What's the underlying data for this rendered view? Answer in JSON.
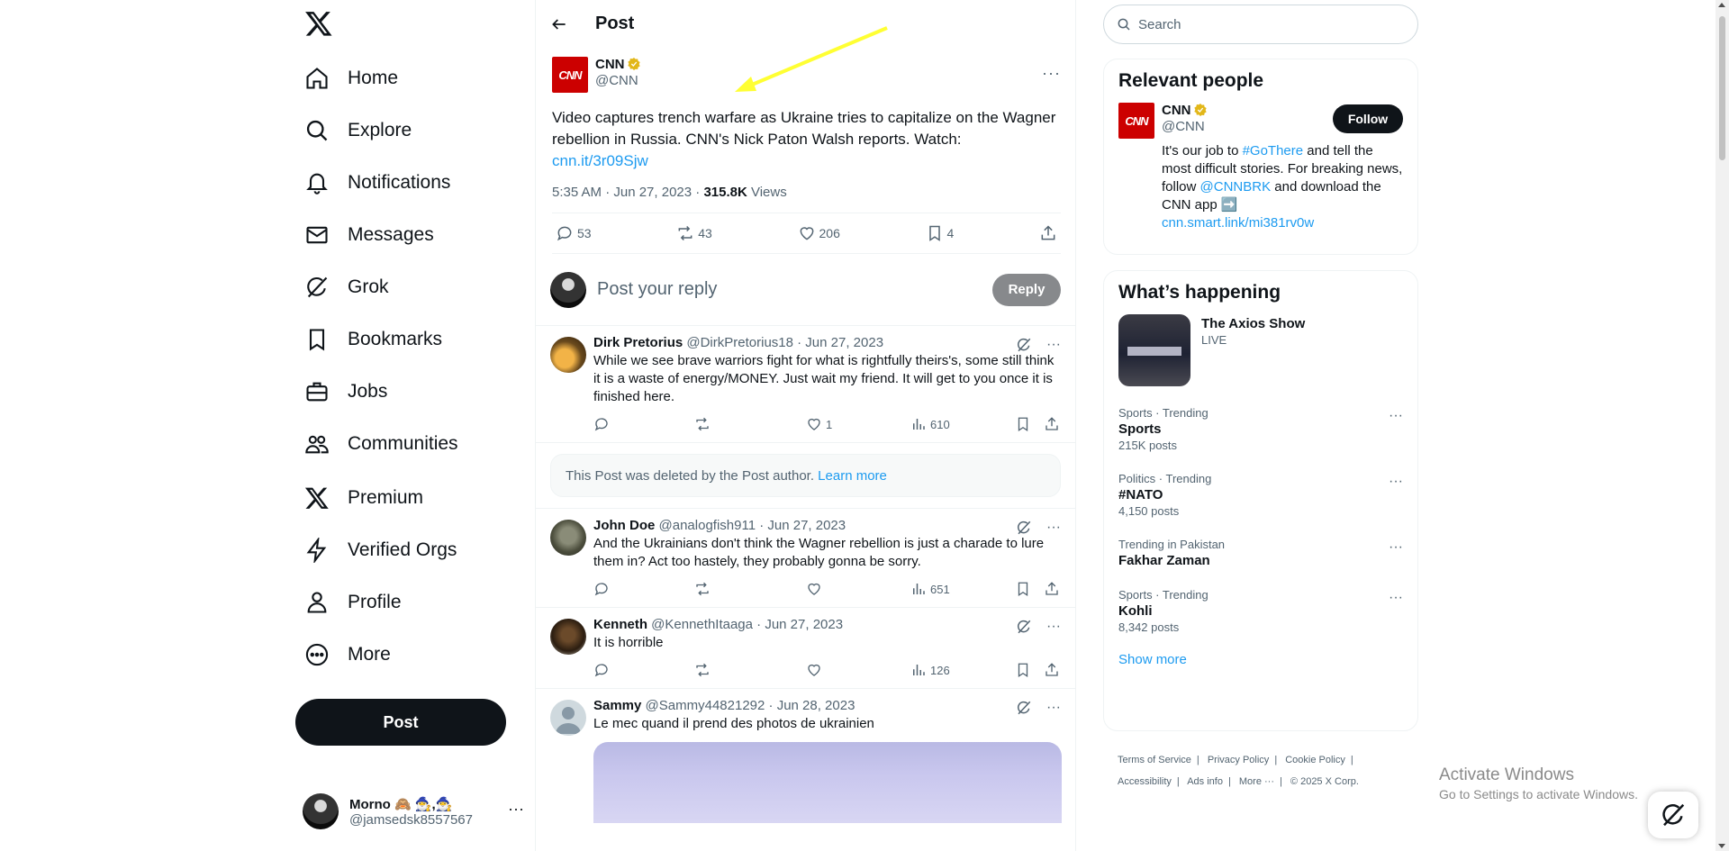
{
  "colors": {
    "accent": "#1d9bf0",
    "text": "#0f1419",
    "muted": "#536471",
    "cnn_red": "#cc0000",
    "annotation_arrow": "#ffff33"
  },
  "sidebar": {
    "logo_icon": "x-logo-icon",
    "items": [
      {
        "label": "Home",
        "icon": "home-icon"
      },
      {
        "label": "Explore",
        "icon": "search-icon"
      },
      {
        "label": "Notifications",
        "icon": "bell-icon"
      },
      {
        "label": "Messages",
        "icon": "mail-icon"
      },
      {
        "label": "Grok",
        "icon": "grok-icon"
      },
      {
        "label": "Bookmarks",
        "icon": "bookmark-icon"
      },
      {
        "label": "Jobs",
        "icon": "briefcase-icon"
      },
      {
        "label": "Communities",
        "icon": "people-icon"
      },
      {
        "label": "Premium",
        "icon": "x-logo-icon"
      },
      {
        "label": "Verified Orgs",
        "icon": "lightning-icon"
      },
      {
        "label": "Profile",
        "icon": "person-icon"
      },
      {
        "label": "More",
        "icon": "more-circle-icon"
      }
    ],
    "post_label": "Post",
    "account": {
      "name": "Morno 🙈 🧙‍♂️,🧙‍♂️",
      "handle": "@jamsedsk8557567"
    }
  },
  "main": {
    "header_title": "Post",
    "post": {
      "author_name": "CNN",
      "author_handle": "@CNN",
      "avatar_text": "CNN",
      "text": "Video captures trench warfare as Ukraine tries to capitalize on the Wagner rebellion in Russia. CNN's Nick Paton Walsh reports. Watch:",
      "link": "cnn.it/3r09Sjw",
      "timestamp": "5:35 AM · Jun 27, 2023 · ",
      "views_count": "315.8K",
      "views_label": " Views",
      "replies": "53",
      "reposts": "43",
      "likes": "206",
      "bookmarks": "4"
    },
    "reply_box": {
      "placeholder": "Post your reply",
      "button": "Reply"
    },
    "replies": [
      {
        "name": "Dirk Pretorius",
        "handle": "@DirkPretorius18",
        "date": " · Jun 27, 2023",
        "text": "While we see brave warriors fight for what is rightfully theirs's, some still think it is a waste of energy/MONEY. Just wait my friend. It will get to you once it is finished here.",
        "likes": "1",
        "views": "610"
      },
      {
        "name": "John Doe",
        "handle": "@analogfish911",
        "date": " · Jun 27, 2023",
        "text": "And the Ukrainians don't think the Wagner rebellion is just a charade to lure them in? Act too hastely, they probably gonna be sorry.",
        "likes": "",
        "views": "651"
      },
      {
        "name": "Kenneth",
        "handle": "@KennethItaaga",
        "date": " · Jun 27, 2023",
        "text": "It is horrible",
        "likes": "",
        "views": "126"
      },
      {
        "name": "Sammy",
        "handle": "@Sammy44821292",
        "date": " · Jun 28, 2023",
        "text": "Le mec quand il prend des photos de ukrainien"
      }
    ],
    "deleted_notice": {
      "text": "This Post was deleted by the Post author. ",
      "link": "Learn more"
    }
  },
  "right": {
    "search_placeholder": "Search",
    "relevant": {
      "title": "Relevant people",
      "name": "CNN",
      "handle": "@CNN",
      "follow": "Follow",
      "bio_1": "It's our job to ",
      "bio_tag": "#GoThere",
      "bio_2": " and tell the most difficult stories. For breaking news, follow ",
      "bio_mention": "@CNNBRK",
      "bio_3": " and download the CNN app ➡️",
      "bio_link": "cnn.smart.link/mi381rv0w"
    },
    "happening": {
      "title": "What’s happening",
      "show": {
        "title": "The Axios Show",
        "status": "LIVE"
      },
      "trends": [
        {
          "category": "Sports · Trending",
          "title": "Sports",
          "count": "215K posts"
        },
        {
          "category": "Politics · Trending",
          "title": "#NATO",
          "count": "4,150 posts"
        },
        {
          "category": "Trending in Pakistan",
          "title": "Fakhar Zaman",
          "count": ""
        },
        {
          "category": "Sports · Trending",
          "title": "Kohli",
          "count": "8,342 posts"
        }
      ],
      "show_more": "Show more"
    },
    "footer": [
      "Terms of Service",
      "Privacy Policy",
      "Cookie Policy",
      "Accessibility",
      "Ads info",
      "More ···",
      "© 2025 X Corp."
    ]
  },
  "overlay": {
    "activate_title": "Activate Windows",
    "activate_sub": "Go to Settings to activate Windows."
  }
}
